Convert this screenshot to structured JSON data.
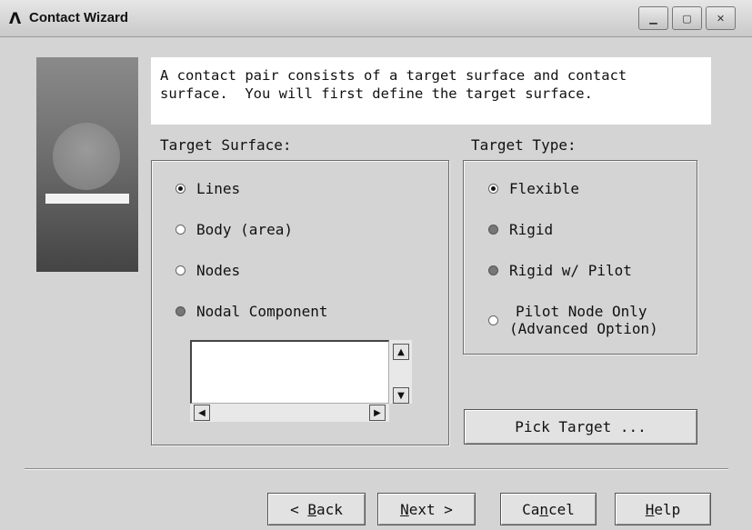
{
  "window": {
    "title": "Contact Wizard",
    "logo_glyph": "Λ",
    "controls": {
      "minimize": "▁",
      "maximize": "▢",
      "close": "✕"
    }
  },
  "info": {
    "line1": "A contact pair consists of a target surface and contact",
    "line2": "surface.  You will first define the target surface."
  },
  "target_surface": {
    "label": "Target Surface:",
    "options": [
      {
        "label": "Lines",
        "state": "selected"
      },
      {
        "label": "Body (area)",
        "state": "unselected"
      },
      {
        "label": "Nodes",
        "state": "unselected"
      },
      {
        "label": "Nodal Component",
        "state": "disabled"
      }
    ],
    "scroll_glyphs": {
      "up": "▲",
      "down": "▼",
      "left": "◀",
      "right": "▶"
    }
  },
  "target_type": {
    "label": "Target Type:",
    "options": [
      {
        "label": "Flexible",
        "state": "selected"
      },
      {
        "label": "Rigid",
        "state": "disabled"
      },
      {
        "label": "Rigid w/ Pilot",
        "state": "disabled"
      },
      {
        "label_line1": "Pilot Node Only",
        "label_line2": "(Advanced Option)",
        "state": "unselected"
      }
    ]
  },
  "buttons": {
    "pick_target": "Pick Target ...",
    "back_prefix": "< ",
    "back_key": "B",
    "back_rest": "ack",
    "next_key": "N",
    "next_rest": "ext >",
    "cancel_pre": "Ca",
    "cancel_key": "n",
    "cancel_rest": "cel",
    "help_key": "H",
    "help_rest": "elp"
  }
}
